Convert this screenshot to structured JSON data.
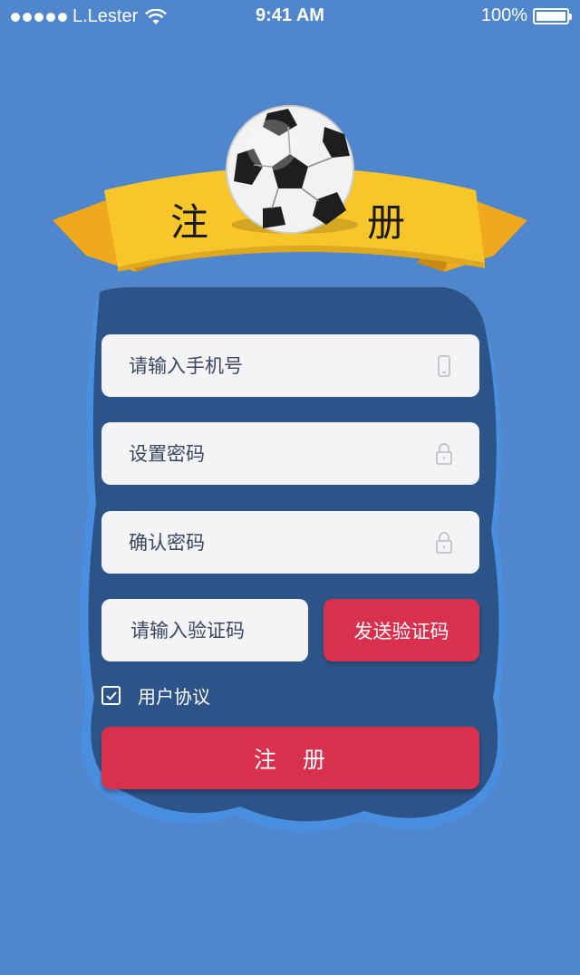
{
  "status_bar": {
    "carrier": "L.Lester",
    "time": "9:41 AM",
    "battery": "100%",
    "battery_level": 1.0
  },
  "header": {
    "title_left": "注",
    "title_right": "册",
    "ribbon_color": "#f8c52a",
    "decoration_icon": "soccer-ball-icon"
  },
  "form": {
    "phone": {
      "placeholder": "请输入手机号",
      "icon": "phone-icon"
    },
    "password": {
      "placeholder": "设置密码",
      "icon": "lock-icon"
    },
    "confirm_password": {
      "placeholder": "确认密码",
      "icon": "lock-icon"
    },
    "code": {
      "placeholder": "请输入验证码"
    },
    "send_code_label": "发送验证码",
    "agreement_label": "用户协议",
    "agreement_checked": true,
    "submit_label": "注　册"
  },
  "colors": {
    "background": "#5086cc",
    "card": "#2c5488",
    "accent": "#d9314d",
    "field": "#f4f4f7"
  }
}
